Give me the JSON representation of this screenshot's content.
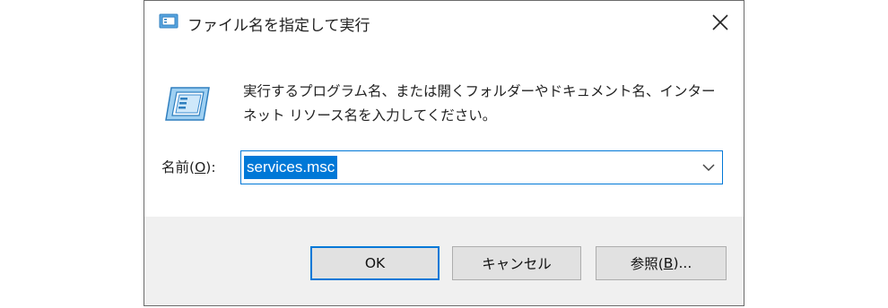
{
  "window": {
    "title": "ファイル名を指定して実行",
    "title_icon": "run-icon",
    "close_icon": "close-icon"
  },
  "description": {
    "line1": "実行するプログラム名、または開くフォルダーやドキュメント名、インター",
    "line2": "ネット リソース名を入力してください。"
  },
  "name_field": {
    "label_prefix": "名前(",
    "label_accel": "O",
    "label_suffix": "):",
    "value": "services.msc",
    "dropdown_icon": "chevron-down-icon"
  },
  "buttons": {
    "ok": "OK",
    "cancel": "キャンセル",
    "browse_prefix": "参照(",
    "browse_accel": "B",
    "browse_suffix": ")..."
  },
  "colors": {
    "accent": "#0078d7",
    "footer_bg": "#f0f0f0",
    "button_bg": "#e1e1e1"
  }
}
